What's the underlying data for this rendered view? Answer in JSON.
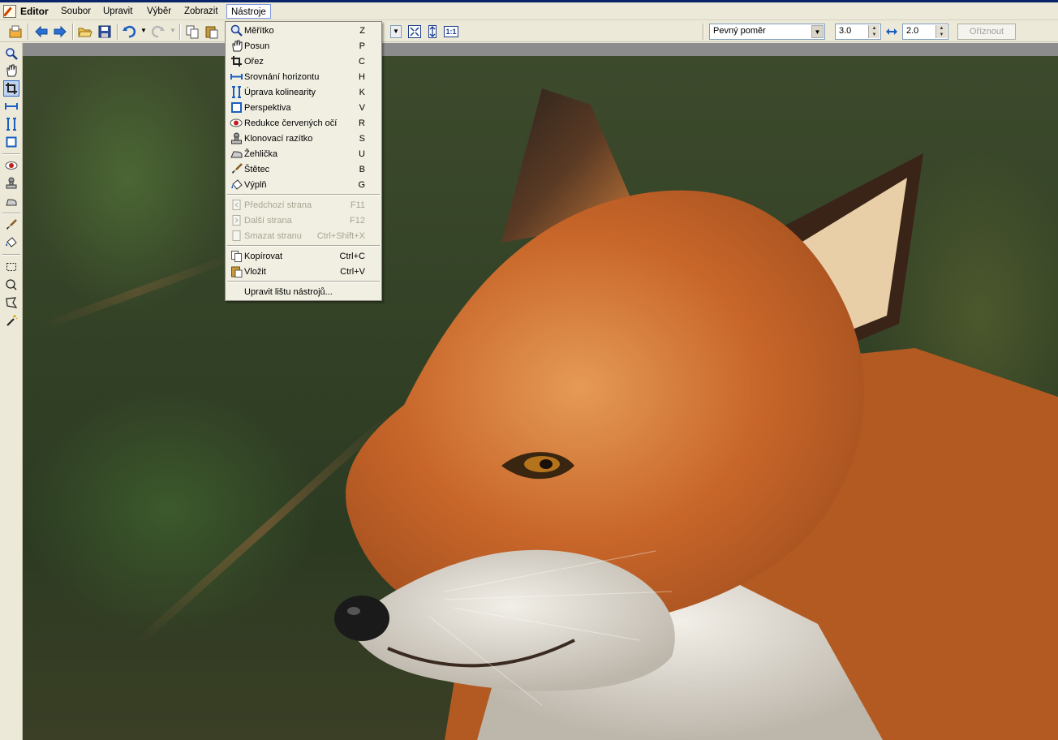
{
  "app": {
    "title": "Editor",
    "icon": "editor-pencil-icon"
  },
  "menubar": {
    "items": [
      "Soubor",
      "Upravit",
      "Výběr",
      "Zobrazit",
      "Nástroje"
    ],
    "active": "Nástroje"
  },
  "toolbar": {
    "ratio_select": "Pevný poměr",
    "width_value": "3.0",
    "height_value": "2.0",
    "crop_button": "Oříznout",
    "buttons": [
      "open-icon",
      "back-icon",
      "forward-icon",
      "folder-open-icon",
      "save-icon",
      "undo-icon",
      "redo-icon",
      "copy-icon",
      "paste-icon",
      "fit-screen-icon",
      "fit-height-icon",
      "actual-size-icon"
    ],
    "actual_size_label": "1:1"
  },
  "tools_menu": {
    "items": [
      {
        "label": "Měřítko",
        "shortcut": "Z",
        "icon": "zoom-icon",
        "enabled": true
      },
      {
        "label": "Posun",
        "shortcut": "P",
        "icon": "hand-icon",
        "enabled": true
      },
      {
        "label": "Ořez",
        "shortcut": "C",
        "icon": "crop-icon",
        "enabled": true
      },
      {
        "label": "Srovnání horizontu",
        "shortcut": "H",
        "icon": "horizon-icon",
        "enabled": true
      },
      {
        "label": "Úprava kolinearity",
        "shortcut": "K",
        "icon": "collinearity-icon",
        "enabled": true
      },
      {
        "label": "Perspektiva",
        "shortcut": "V",
        "icon": "perspective-icon",
        "enabled": true
      },
      {
        "label": "Redukce červených očí",
        "shortcut": "R",
        "icon": "red-eye-icon",
        "enabled": true
      },
      {
        "label": "Klonovací razítko",
        "shortcut": "S",
        "icon": "clone-stamp-icon",
        "enabled": true
      },
      {
        "label": "Žehlička",
        "shortcut": "U",
        "icon": "iron-icon",
        "enabled": true
      },
      {
        "label": "Štětec",
        "shortcut": "B",
        "icon": "brush-icon",
        "enabled": true
      },
      {
        "label": "Výplň",
        "shortcut": "G",
        "icon": "fill-bucket-icon",
        "enabled": true
      },
      {
        "label": "Předchozí strana",
        "shortcut": "F11",
        "icon": "previous-page-icon",
        "enabled": false
      },
      {
        "label": "Další strana",
        "shortcut": "F12",
        "icon": "next-page-icon",
        "enabled": false
      },
      {
        "label": "Smazat stranu",
        "shortcut": "Ctrl+Shift+X",
        "icon": "delete-page-icon",
        "enabled": false
      },
      {
        "label": "Kopírovat",
        "shortcut": "Ctrl+C",
        "icon": "copy-icon",
        "enabled": true
      },
      {
        "label": "Vložit",
        "shortcut": "Ctrl+V",
        "icon": "paste-icon",
        "enabled": true
      },
      {
        "label": "Upravit lištu nástrojů...",
        "shortcut": "",
        "icon": "",
        "enabled": true
      }
    ]
  },
  "toolbox": {
    "tools": [
      "zoom-icon",
      "hand-icon",
      "crop-icon",
      "horizon-icon",
      "collinearity-icon",
      "perspective-icon",
      "red-eye-icon",
      "clone-stamp-icon",
      "iron-icon",
      "brush-icon",
      "fill-bucket-icon",
      "rect-select-icon",
      "ellipse-select-icon",
      "lasso-select-icon",
      "magic-wand-icon"
    ],
    "selected": "crop-icon"
  },
  "colors": {
    "menu_highlight": "#7a96df",
    "selection": "#316ac5",
    "title_bar": "#0a246a"
  }
}
